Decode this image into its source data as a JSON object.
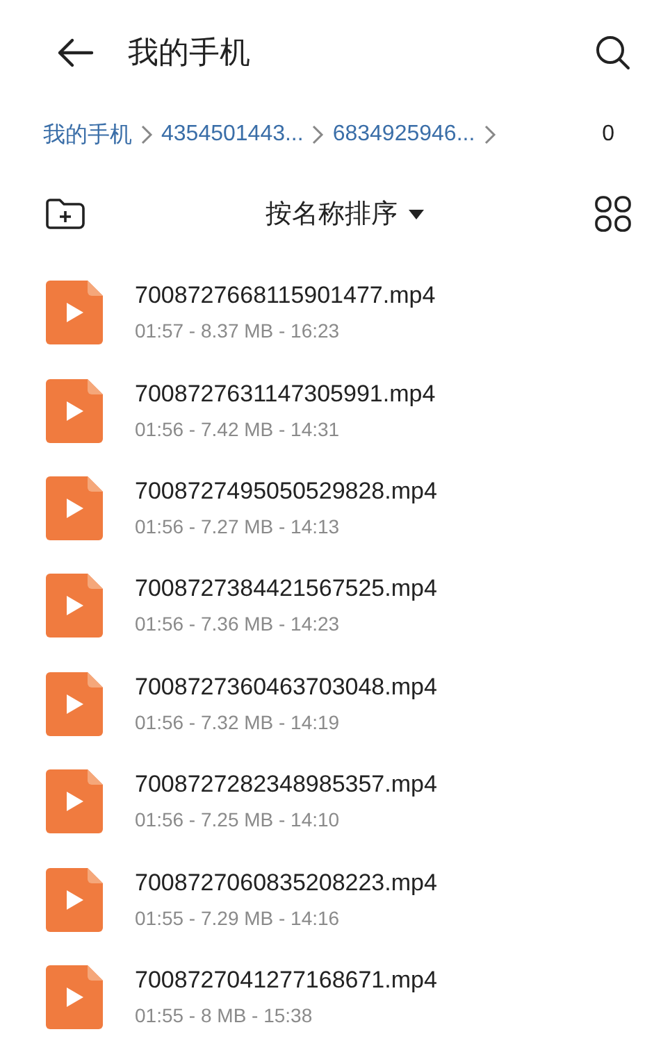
{
  "header": {
    "title": "我的手机"
  },
  "breadcrumb": {
    "items": [
      "我的手机",
      "4354501443...",
      "6834925946..."
    ],
    "count": "0"
  },
  "toolbar": {
    "sort_label": "按名称排序"
  },
  "files": [
    {
      "name": "7008727668115901477.mp4",
      "details": "01:57 - 8.37 MB - 16:23"
    },
    {
      "name": "7008727631147305991.mp4",
      "details": "01:56 - 7.42 MB - 14:31"
    },
    {
      "name": "7008727495050529828.mp4",
      "details": "01:56 - 7.27 MB - 14:13"
    },
    {
      "name": "7008727384421567525.mp4",
      "details": "01:56 - 7.36 MB - 14:23"
    },
    {
      "name": "7008727360463703048.mp4",
      "details": "01:56 - 7.32 MB - 14:19"
    },
    {
      "name": "7008727282348985357.mp4",
      "details": "01:56 - 7.25 MB - 14:10"
    },
    {
      "name": "7008727060835208223.mp4",
      "details": "01:55 - 7.29 MB - 14:16"
    },
    {
      "name": "7008727041277168671.mp4",
      "details": "01:55 - 8 MB - 15:38"
    }
  ]
}
